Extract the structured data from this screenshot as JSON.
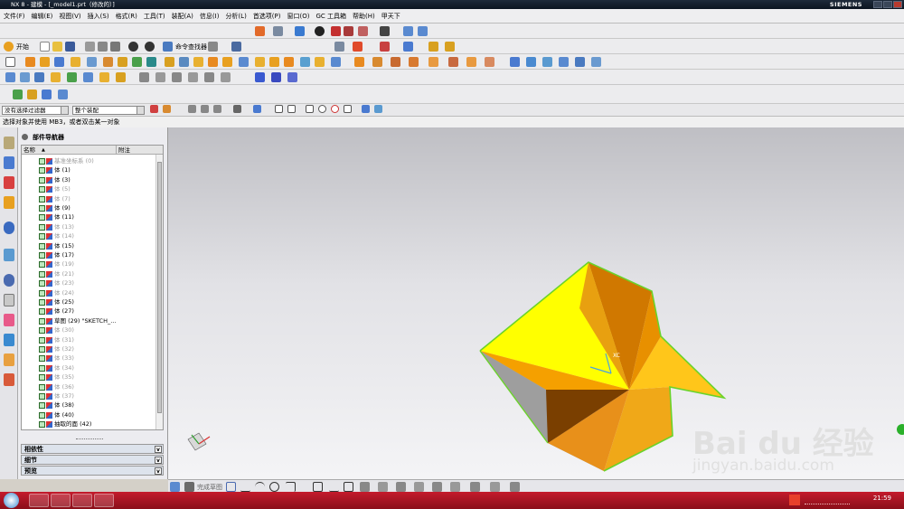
{
  "window": {
    "title": "NX 8 - 建模 - [_model1.prt（修改的）]",
    "brand": "SIEMENS"
  },
  "menu": [
    "文件(F)",
    "编辑(E)",
    "视图(V)",
    "插入(S)",
    "格式(R)",
    "工具(T)",
    "装配(A)",
    "信息(I)",
    "分析(L)",
    "首选项(P)",
    "窗口(O)",
    "GC 工具箱",
    "帮助(H)",
    "甲天下"
  ],
  "toolbar": {
    "start_label": "开始",
    "command_finder_label": "命令查找器"
  },
  "selection": {
    "filter_value": "没有选择过滤器",
    "scope_value": "整个装配"
  },
  "prompt": "选择对象并使用 MB3，或者双击某一对象",
  "navigator": {
    "title": "部件导航器",
    "columns": [
      "名称",
      "附注"
    ],
    "rows": [
      {
        "label": "基准坐标系 (0)",
        "dim": true
      },
      {
        "label": "体 (1)",
        "dim": false
      },
      {
        "label": "体 (3)",
        "dim": false
      },
      {
        "label": "体 (5)",
        "dim": true
      },
      {
        "label": "体 (7)",
        "dim": true
      },
      {
        "label": "体 (9)",
        "dim": false
      },
      {
        "label": "体 (11)",
        "dim": false
      },
      {
        "label": "体 (13)",
        "dim": true
      },
      {
        "label": "体 (14)",
        "dim": true
      },
      {
        "label": "体 (15)",
        "dim": false
      },
      {
        "label": "体 (17)",
        "dim": false
      },
      {
        "label": "体 (19)",
        "dim": true
      },
      {
        "label": "体 (21)",
        "dim": true
      },
      {
        "label": "体 (23)",
        "dim": true
      },
      {
        "label": "体 (24)",
        "dim": true
      },
      {
        "label": "体 (25)",
        "dim": false
      },
      {
        "label": "体 (27)",
        "dim": false
      },
      {
        "label": "草图 (29) \"SKETCH_...",
        "dim": false
      },
      {
        "label": "体 (30)",
        "dim": true
      },
      {
        "label": "体 (31)",
        "dim": true
      },
      {
        "label": "体 (32)",
        "dim": true
      },
      {
        "label": "体 (33)",
        "dim": true
      },
      {
        "label": "体 (34)",
        "dim": true
      },
      {
        "label": "体 (35)",
        "dim": true
      },
      {
        "label": "体 (36)",
        "dim": true
      },
      {
        "label": "体 (37)",
        "dim": true
      },
      {
        "label": "体 (38)",
        "dim": false
      },
      {
        "label": "体 (40)",
        "dim": false
      },
      {
        "label": "抽取的面 (42)",
        "dim": false
      }
    ],
    "panels": [
      "相依性",
      "细节",
      "预览"
    ]
  },
  "statusbar": {
    "sketch_label": "完成草图"
  },
  "watermark": {
    "logo": "Bai du 经验",
    "url": "jingyan.baidu.com"
  },
  "taskbar": {
    "clock": "21:59"
  }
}
